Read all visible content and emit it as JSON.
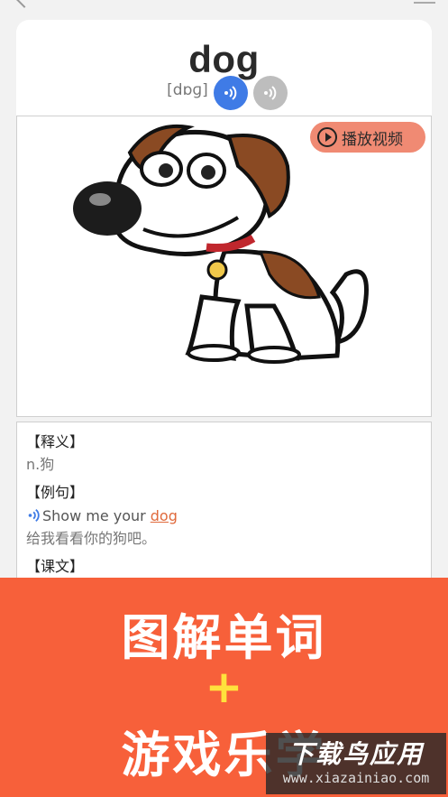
{
  "word": {
    "text": "dog",
    "phonetic": "[dɒɡ]"
  },
  "media": {
    "play_video_label": "播放视频"
  },
  "definition": {
    "title": "【释义】",
    "text": "n.狗"
  },
  "example": {
    "title": "【例句】",
    "sentence_prefix": "Show me your",
    "sentence_word": "dog",
    "translation": "给我看看你的狗吧。"
  },
  "text_section": {
    "title": "【课文】"
  },
  "banner": {
    "line1": "图解单词",
    "plus": "+",
    "line2": "游戏乐学"
  },
  "watermark": {
    "name": "下载鸟应用",
    "url": "www.xiazainiao.com"
  },
  "colors": {
    "accent_blue": "#3f7be6",
    "banner_orange": "#f7603a",
    "play_button": "#f08a73",
    "highlight_word": "#e06a3c",
    "plus_yellow": "#ffe23c"
  }
}
